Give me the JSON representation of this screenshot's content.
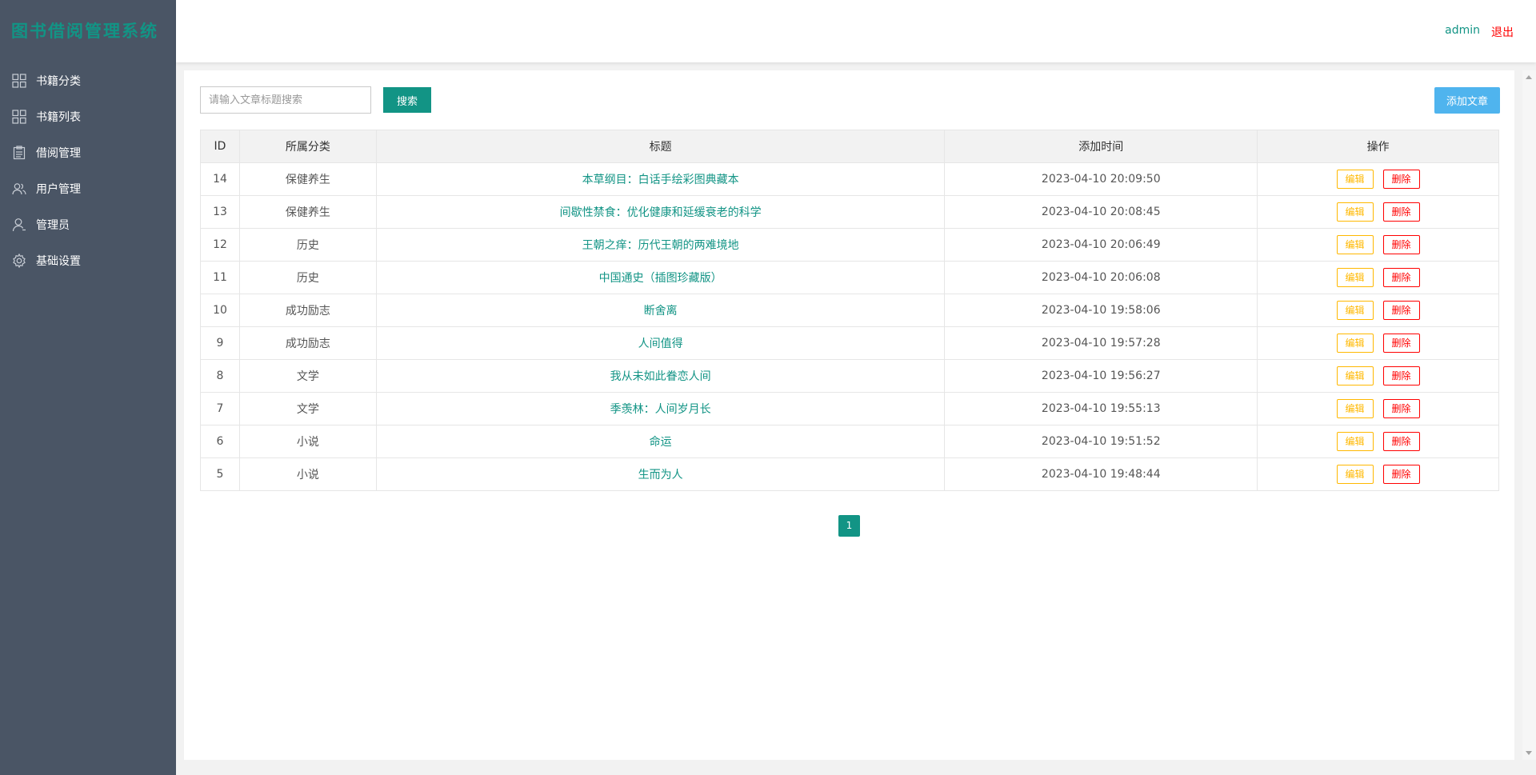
{
  "app": {
    "title": "图书借阅管理系统"
  },
  "sidebar": {
    "items": [
      {
        "label": "书籍分类",
        "icon": "grid-icon"
      },
      {
        "label": "书籍列表",
        "icon": "grid-icon"
      },
      {
        "label": "借阅管理",
        "icon": "clipboard-icon"
      },
      {
        "label": "用户管理",
        "icon": "users-icon"
      },
      {
        "label": "管理员",
        "icon": "user-icon"
      },
      {
        "label": "基础设置",
        "icon": "gear-icon"
      }
    ]
  },
  "header": {
    "user": "admin",
    "logout": "退出"
  },
  "toolbar": {
    "search_placeholder": "请输入文章标题搜索",
    "search_button": "搜索",
    "add_button": "添加文章"
  },
  "table": {
    "headers": [
      "ID",
      "所属分类",
      "标题",
      "添加时间",
      "操作"
    ],
    "edit_label": "编辑",
    "delete_label": "删除",
    "rows": [
      {
        "id": "14",
        "category": "保健养生",
        "title": "本草纲目：白话手绘彩图典藏本",
        "time": "2023-04-10 20:09:50"
      },
      {
        "id": "13",
        "category": "保健养生",
        "title": "间歇性禁食：优化健康和延缓衰老的科学",
        "time": "2023-04-10 20:08:45"
      },
      {
        "id": "12",
        "category": "历史",
        "title": "王朝之痒：历代王朝的两难境地",
        "time": "2023-04-10 20:06:49"
      },
      {
        "id": "11",
        "category": "历史",
        "title": "中国通史（插图珍藏版）",
        "time": "2023-04-10 20:06:08"
      },
      {
        "id": "10",
        "category": "成功励志",
        "title": "断舍离",
        "time": "2023-04-10 19:58:06"
      },
      {
        "id": "9",
        "category": "成功励志",
        "title": "人间值得",
        "time": "2023-04-10 19:57:28"
      },
      {
        "id": "8",
        "category": "文学",
        "title": "我从未如此眷恋人间",
        "time": "2023-04-10 19:56:27"
      },
      {
        "id": "7",
        "category": "文学",
        "title": "季羡林：人间岁月长",
        "time": "2023-04-10 19:55:13"
      },
      {
        "id": "6",
        "category": "小说",
        "title": "命运",
        "time": "2023-04-10 19:51:52"
      },
      {
        "id": "5",
        "category": "小说",
        "title": "生而为人",
        "time": "2023-04-10 19:48:44"
      }
    ]
  },
  "pagination": {
    "current": "1"
  },
  "colors": {
    "sidebar": "#4a5565",
    "accent": "#129485",
    "add_button": "#4fb4ee",
    "edit": "#ffb800",
    "delete": "#ff0000"
  }
}
